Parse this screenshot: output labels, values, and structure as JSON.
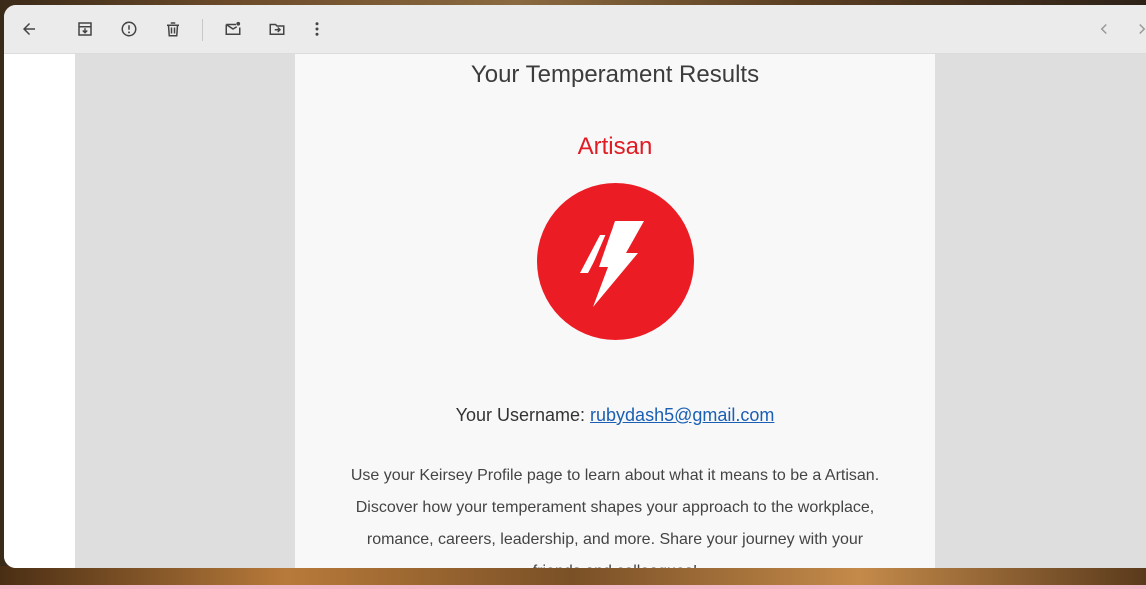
{
  "toolbar": {
    "icons": [
      "back-arrow-icon",
      "archive-icon",
      "report-spam-icon",
      "delete-icon",
      "mark-unread-icon",
      "move-to-icon",
      "more-vert-icon",
      "prev-icon",
      "next-icon"
    ]
  },
  "email": {
    "heading": "Your Temperament Results",
    "temperament": "Artisan",
    "username_label": "Your Username:",
    "username_value": "rubydash5@gmail.com",
    "description_lines": [
      "Use your Keirsey Profile page to learn about what it means to be a Artisan.",
      "Discover how your temperament shapes your approach to the workplace,",
      "romance, careers, leadership, and more. Share your journey with your",
      "friends and colleagues!"
    ]
  },
  "colors": {
    "accent_red": "#ec1c24",
    "link_blue": "#1a5fb4",
    "toolbar_bg": "#ebebeb",
    "gutter_gray": "#dedede"
  }
}
